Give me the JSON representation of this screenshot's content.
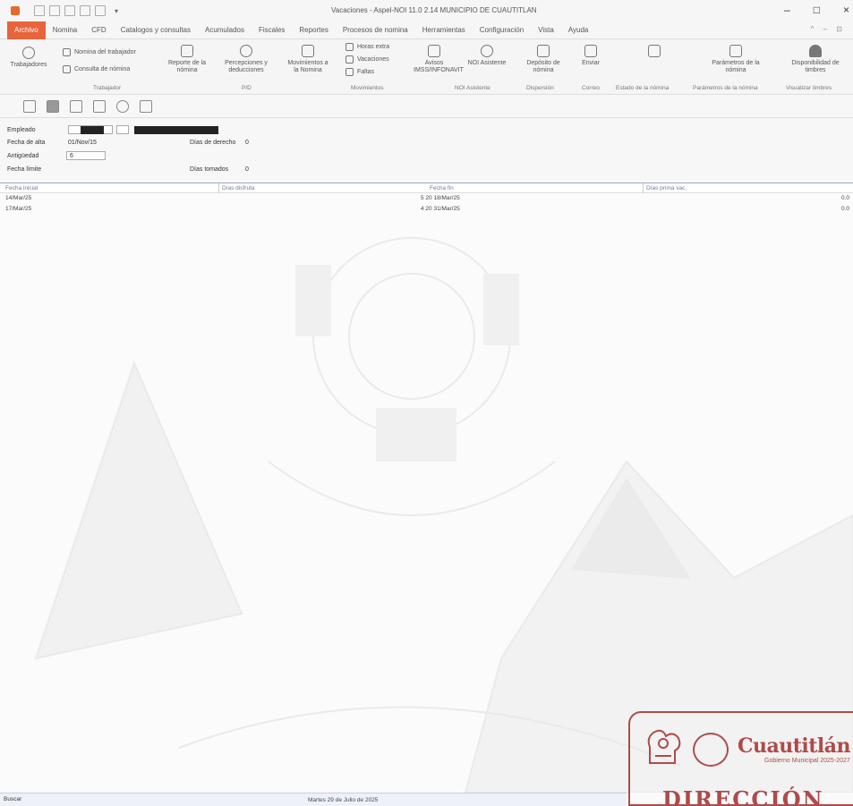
{
  "window": {
    "title": "Vacaciones - Aspel-NOI 11.0 2.14 MUNICIPIO DE CUAUTITLAN"
  },
  "menu": {
    "tabs": [
      "Archivo",
      "Nomina",
      "CFD",
      "Catalogos y consultas",
      "Acumulados",
      "Fiscales",
      "Reportes",
      "Procesos de nomina",
      "Herramientas",
      "Configuración",
      "Vista",
      "Ayuda"
    ],
    "active": "Archivo"
  },
  "ribbon": {
    "trabajadores": "Trabajadores",
    "nomina_trabajador": "Nomina del trabajador",
    "consulta_nomina": "Consulta de nómina",
    "grupo_trabajador": "Trabajador",
    "reporte_nomina": "Reporte de la nómina",
    "percepciones": "Percepciones y deducciones",
    "grupo_pd": "P/D",
    "movimientos_nomina": "Movimientos a la Nomina",
    "horas_extra": "Horas extra",
    "vacaciones": "Vacaciones",
    "faltas": "Faltas",
    "grupo_movimientos": "Movimientos",
    "avisos": "Avisos IMSS/INFONAVIT",
    "noi_asistente": "NOI Asistente",
    "grupo_noi": "NOI Asistente",
    "dispersion": "Depósito de nómina",
    "grupo_dispersion": "Dispersión",
    "enviar": "Enviar",
    "grupo_correo": "Correo",
    "estado_nomina": "Estado de la nómina",
    "parametros": "Parámetros de la nómina",
    "grupo_parametros": "Parámetros de la nómina",
    "disponibilidad": "Disponibilidad de timbres",
    "grupo_visualizar": "Visualizar timbres"
  },
  "form": {
    "empleado_label": "Empleado",
    "fecha_alta_label": "Fecha de alta",
    "fecha_alta_value": "01/Nov/15",
    "antiguedad_label": "Antigüedad",
    "antiguedad_value": "6",
    "fecha_limite_label": "Fecha límite",
    "dias_derecho_label": "Días de derecho",
    "dias_derecho_value": "0",
    "dias_tomados_label": "Días tomados",
    "dias_tomados_value": "0"
  },
  "table": {
    "headers": [
      "Fecha inicial",
      "Días disfruta",
      "Fecha fin",
      "Días prima vac."
    ],
    "rows": [
      {
        "c1": "14/Mar/25",
        "c3": "5 20 18/Mar/25",
        "c4": "0.0"
      },
      {
        "c1": "17/Mar/25",
        "c3": "4 20 31/Mar/25",
        "c4": "0.0"
      }
    ]
  },
  "stamp": {
    "name": "Cuautitlán",
    "sub": "Gobierno Municipal 2025-2027",
    "big": "DIRECCIÓN DE"
  },
  "status": {
    "search": "Buscar",
    "date": "Martes 29 de Julio de 2025"
  },
  "colors": {
    "accent": "#e8643c",
    "stamp": "#b04a4a"
  }
}
